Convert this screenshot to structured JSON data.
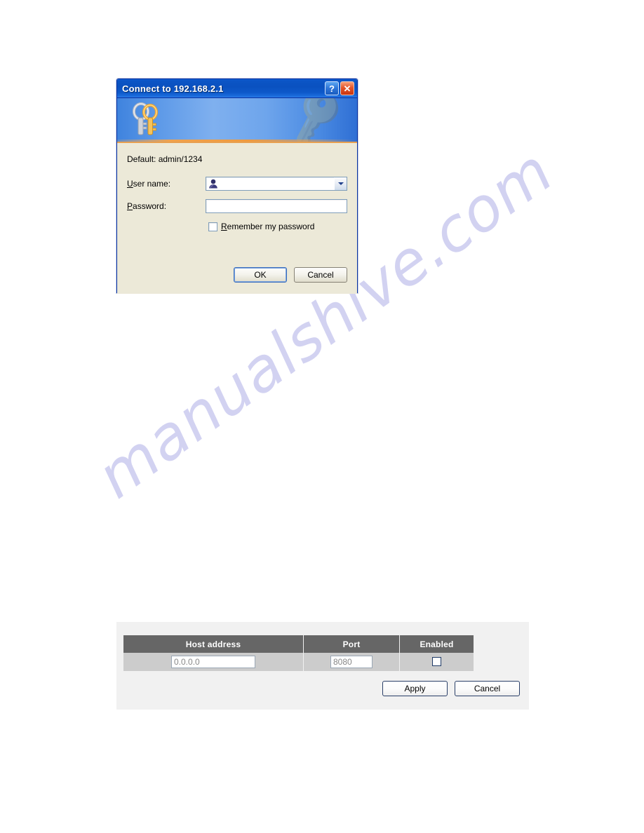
{
  "page": {
    "background_color": "#ffffff",
    "watermark_text": "manualshive.com",
    "watermark_color": "#c9c9ef"
  },
  "dialog": {
    "title": "Connect to 192.168.2.1",
    "help_button_label": "?",
    "close_button_label": "✕",
    "banner_icon": "keys-icon",
    "hint": "Default: admin/1234",
    "username": {
      "label": "User name:",
      "label_accesskey": "U",
      "value": "",
      "icon": "user-icon",
      "dropdown_icon": "chevron-down-icon"
    },
    "password": {
      "label": "Password:",
      "label_accesskey": "P",
      "value": ""
    },
    "remember": {
      "label": "Remember my password",
      "label_accesskey": "R",
      "checked": false
    },
    "buttons": {
      "ok": "OK",
      "cancel": "Cancel"
    },
    "colors": {
      "titlebar": "#0b55c6",
      "body": "#ece9d8",
      "border": "#0831a0",
      "close_button": "#e4552a"
    }
  },
  "web_panel": {
    "table": {
      "headers": [
        "Host address",
        "Port",
        "Enabled"
      ],
      "rows": [
        {
          "host_address": "0.0.0.0",
          "port": "8080",
          "enabled": false
        }
      ]
    },
    "buttons": {
      "apply": "Apply",
      "cancel": "Cancel"
    },
    "colors": {
      "panel": "#f1f1f1",
      "header": "#666666",
      "row": "#cccccc",
      "button_border": "#2a3f68"
    }
  }
}
